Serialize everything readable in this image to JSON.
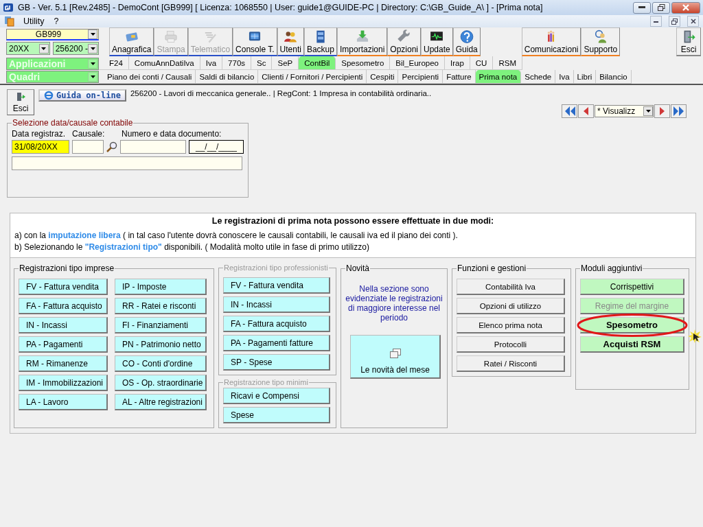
{
  "window": {
    "title": "GB - Ver. 5.1 [Rev.2485] -  DemoCont [GB999]    [ Licenza: 1068550 | User: guide1@GUIDE-PC | Directory: C:\\GB_Guide_A\\ ] - [Prima nota]"
  },
  "menu": [
    "Utility",
    "?"
  ],
  "selectors": {
    "company": "GB999",
    "year": "20XX",
    "activity": "256200 -",
    "applications": "Applicazioni",
    "panels": "Quadri"
  },
  "toolbar": [
    {
      "label": "Anagrafica",
      "disabled": false
    },
    {
      "label": "Stampa",
      "disabled": true
    },
    {
      "label": "Telematico",
      "disabled": true
    },
    {
      "label": "Console T.",
      "disabled": false
    },
    {
      "label": "Utenti",
      "disabled": false
    },
    {
      "label": "Backup",
      "disabled": false
    },
    {
      "label": "Importazioni",
      "disabled": false
    },
    {
      "label": "Opzioni",
      "disabled": false
    },
    {
      "label": "Update",
      "disabled": false
    },
    {
      "label": "Guida",
      "disabled": false
    }
  ],
  "toolbar_right": [
    {
      "label": "Comunicazioni",
      "disabled": false
    },
    {
      "label": "Supporto",
      "disabled": false
    }
  ],
  "exit_button": "Esci",
  "tabs": [
    {
      "label": "F24",
      "selected": false
    },
    {
      "label": "ComuAnnDatiIva",
      "selected": false
    },
    {
      "label": "Iva",
      "selected": false
    },
    {
      "label": "770s",
      "selected": false
    },
    {
      "label": "Sc",
      "selected": false
    },
    {
      "label": "SeP",
      "selected": false
    },
    {
      "label": "ContBil",
      "selected": true
    },
    {
      "label": "Spesometro",
      "selected": false
    },
    {
      "label": "Bil_Europeo",
      "selected": false
    },
    {
      "label": "Irap",
      "selected": false
    },
    {
      "label": "CU",
      "selected": false
    },
    {
      "label": "RSM",
      "selected": false
    }
  ],
  "subtabs": [
    {
      "label": "Piano dei conti / Causali",
      "selected": false
    },
    {
      "label": "Saldi di bilancio",
      "selected": false
    },
    {
      "label": "Clienti / Fornitori / Percipienti",
      "selected": false
    },
    {
      "label": "Cespiti",
      "selected": false
    },
    {
      "label": "Percipienti",
      "selected": false
    },
    {
      "label": "Fatture",
      "selected": false
    },
    {
      "label": "Prima nota",
      "selected": true
    },
    {
      "label": "Schede",
      "selected": false
    },
    {
      "label": "Iva",
      "selected": false
    },
    {
      "label": "Libri",
      "selected": false
    },
    {
      "label": "Bilancio",
      "selected": false
    }
  ],
  "content": {
    "exit_button": "Esci",
    "help_button": "Guida on-line",
    "info": "256200 - Lavori di meccanica generale.. | RegCont: 1 Impresa  in contabilità ordinaria..",
    "view": "* Visualizz"
  },
  "selection": {
    "title": "Selezione data/causale contabile",
    "date_label": "Data registraz.",
    "date_value": "31/08/20XX",
    "causale_label": "Causale:",
    "document_label": "Numero e data documento:",
    "document_date": "__/__/____"
  },
  "intro": {
    "heading": "Le registrazioni di prima nota possono essere effettuate in due modi:",
    "lines": [
      [
        {
          "text": "a) con la  ",
          "highlight": false
        },
        {
          "text": "imputazione libera",
          "highlight": true
        },
        {
          "text": "  ( in tal caso l'utente dovrà conoscere le causali contabili, le causali iva ed il piano dei conti ).",
          "highlight": false
        }
      ],
      [
        {
          "text": "b) Selezionando le  ",
          "highlight": false
        },
        {
          "text": "\"Registrazioni tipo\"",
          "highlight": true
        },
        {
          "text": " disponibili. ( Modalità molto utile in fase di primo utilizzo)",
          "highlight": false
        }
      ]
    ]
  },
  "companies": {
    "title": "Registrazioni tipo imprese",
    "disabled": false,
    "columns": [
      [
        "FV - Fattura vendita",
        "FA - Fattura acquisto",
        "IN - Incassi",
        "PA - Pagamenti",
        "RM - Rimanenze",
        "IM - Immobilizzazioni",
        "LA - Lavoro"
      ],
      [
        "IP - Imposte",
        "RR - Ratei e risconti",
        "FI - Finanziamenti",
        "PN - Patrimonio netto",
        "CO - Conti d'ordine",
        "OS - Op. straordinarie",
        "AL - Altre registrazioni"
      ]
    ]
  },
  "professionals": {
    "title": "Registrazioni tipo professionisti",
    "disabled": true,
    "buttons": [
      "FV - Fattura vendita",
      "IN - Incassi",
      "FA - Fattura acquisto",
      "PA - Pagamenti fatture",
      "SP - Spese"
    ]
  },
  "minimum": {
    "title": "Registrazione tipo minimi",
    "disabled": true,
    "buttons": [
      "Ricavi e Compensi",
      "Spese"
    ]
  },
  "news": {
    "title": "Novità",
    "text": "Nella sezione sono evidenziate le registrazioni di maggiore interesse nel periodo",
    "button": "Le novità del mese"
  },
  "functions": {
    "title": "Funzioni e gestioni",
    "buttons": [
      "Contabilità Iva",
      "Opzioni di utilizzo",
      "Elenco prima nota",
      "Protocolli",
      "Ratei / Risconti"
    ]
  },
  "modules": {
    "title": "Moduli aggiuntivi",
    "buttons": [
      {
        "label": "Corrispettivi",
        "disabled": false,
        "bold": false,
        "circled": false
      },
      {
        "label": "Regime del margine",
        "disabled": true,
        "bold": false,
        "circled": false
      },
      {
        "label": "Spesometro",
        "disabled": false,
        "bold": true,
        "circled": true
      },
      {
        "label": "Acquisti RSM",
        "disabled": false,
        "bold": true,
        "circled": false
      }
    ]
  }
}
